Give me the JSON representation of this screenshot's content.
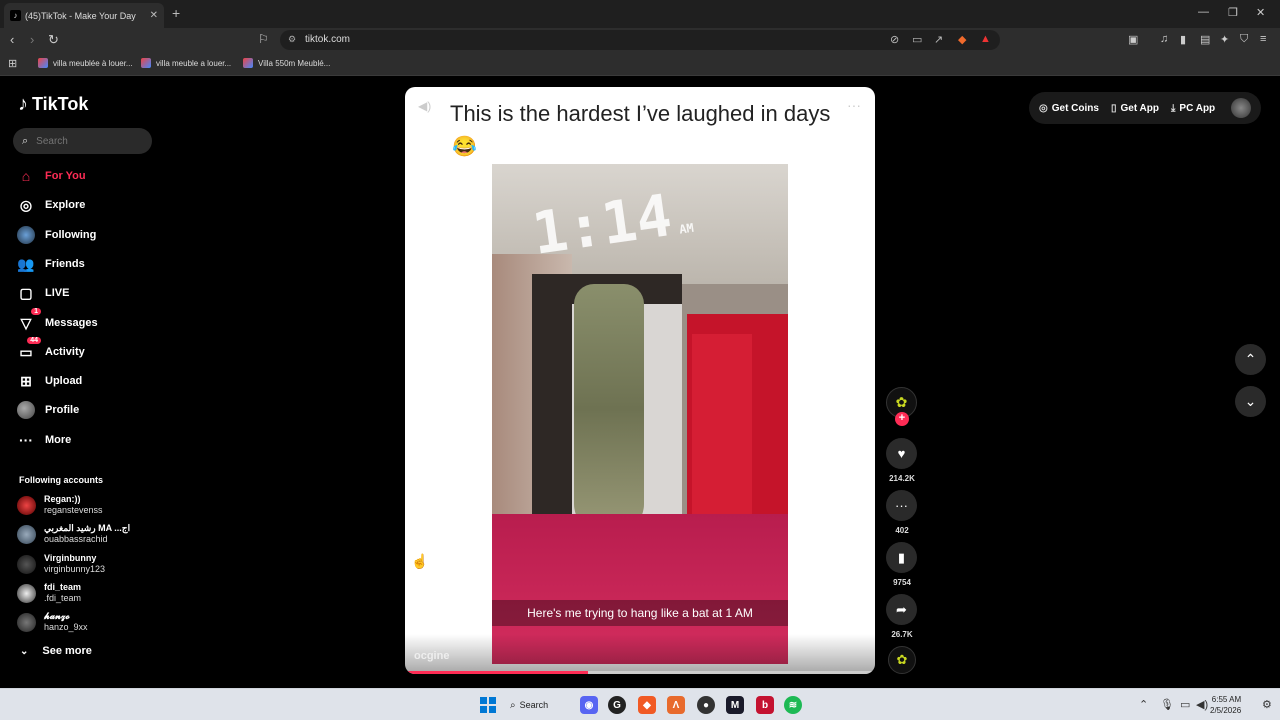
{
  "browser": {
    "tab_title": "(45)TikTok - Make Your Day",
    "tab_close": "✕",
    "new_tab": "+",
    "url": "tiktok.com",
    "bookmarks": [
      "villa meublée à louer...",
      "villa meuble a louer...",
      "Villa 550m Meublé..."
    ]
  },
  "sidebar": {
    "logo": "TikTok",
    "search_placeholder": "Search",
    "nav": [
      {
        "label": "For You",
        "icon": "home-icon",
        "active": true
      },
      {
        "label": "Explore",
        "icon": "compass-icon"
      },
      {
        "label": "Following",
        "icon": "following-avatar-icon"
      },
      {
        "label": "Friends",
        "icon": "friends-icon"
      },
      {
        "label": "LIVE",
        "icon": "live-icon"
      },
      {
        "label": "Messages",
        "icon": "messages-icon",
        "badge": "1"
      },
      {
        "label": "Activity",
        "icon": "activity-icon",
        "badge": "44"
      },
      {
        "label": "Upload",
        "icon": "upload-icon"
      },
      {
        "label": "Profile",
        "icon": "profile-avatar-icon"
      },
      {
        "label": "More",
        "icon": "more-icon"
      }
    ],
    "following_title": "Following accounts",
    "following": [
      {
        "name": "Regan:))",
        "handle": "reganstevenss"
      },
      {
        "name": "رشيد المغربي MA ...اج",
        "handle": "ouabbassrachid"
      },
      {
        "name": "Virginbunny",
        "handle": "virginbunny123"
      },
      {
        "name": "fdi_team",
        "handle": ".fdi_team"
      },
      {
        "name": "𝓱𝓪𝓷𝔃𝓸",
        "handle": "hanzo_9xx"
      }
    ],
    "see_more": "See more"
  },
  "video": {
    "caption": "This is the hardest I’ve laughed in days",
    "emoji": "😂",
    "clock_overlay": "1:14",
    "clock_ampm": "AM",
    "subtitle": "Here's me trying to hang like a bat at 1 AM",
    "author": "ocgine",
    "progress": 0.39
  },
  "actions": {
    "follow_plus": "+",
    "likes": "214.2K",
    "comments": "402",
    "saves": "9754",
    "shares": "26.7K"
  },
  "top_right": {
    "get_coins": "Get Coins",
    "get_app": "Get App",
    "pc_app": "PC App"
  },
  "taskbar": {
    "search": "Search",
    "time": "6:55 AM",
    "date": "2/5/2026"
  },
  "colors": {
    "accent": "#fe2c55",
    "bg": "#000000"
  }
}
